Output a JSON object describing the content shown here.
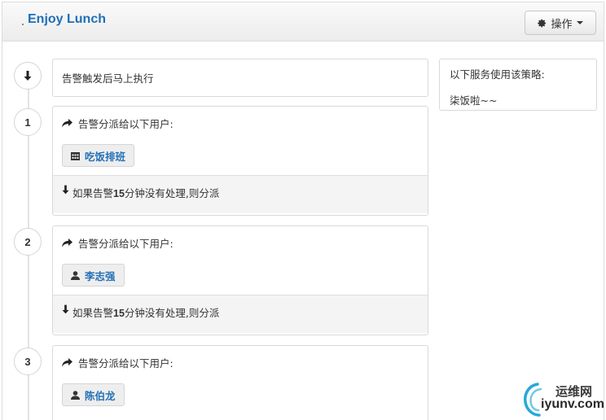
{
  "header": {
    "title": "Enjoy Lunch",
    "ops_button": {
      "label": "操作",
      "icon": "gear-icon"
    }
  },
  "trigger": {
    "icon": "arrow-down-icon",
    "text": "告警触发后马上执行"
  },
  "steps": [
    {
      "number": "1",
      "head_text": "告警分派给以下用户:",
      "chip": {
        "label": "吃饭排班",
        "icon": "calendar-icon"
      },
      "escalation": {
        "prefix": "如果告警",
        "minutes": "15",
        "suffix": "分钟没有处理,则分派"
      }
    },
    {
      "number": "2",
      "head_text": "告警分派给以下用户:",
      "chip": {
        "label": "李志强",
        "icon": "user-icon"
      },
      "escalation": {
        "prefix": "如果告警",
        "minutes": "15",
        "suffix": "分钟没有处理,则分派"
      }
    },
    {
      "number": "3",
      "head_text": "告警分派给以下用户:",
      "chip": {
        "label": "陈伯龙",
        "icon": "user-icon"
      }
    }
  ],
  "services_panel": {
    "title": "以下服务使用该策略:",
    "service": "柒饭啦~~"
  },
  "watermark": {
    "line1": "运维网",
    "line2": "iyunv.com"
  },
  "colors": {
    "link": "#2470b6",
    "title": "#1f6fb6"
  }
}
